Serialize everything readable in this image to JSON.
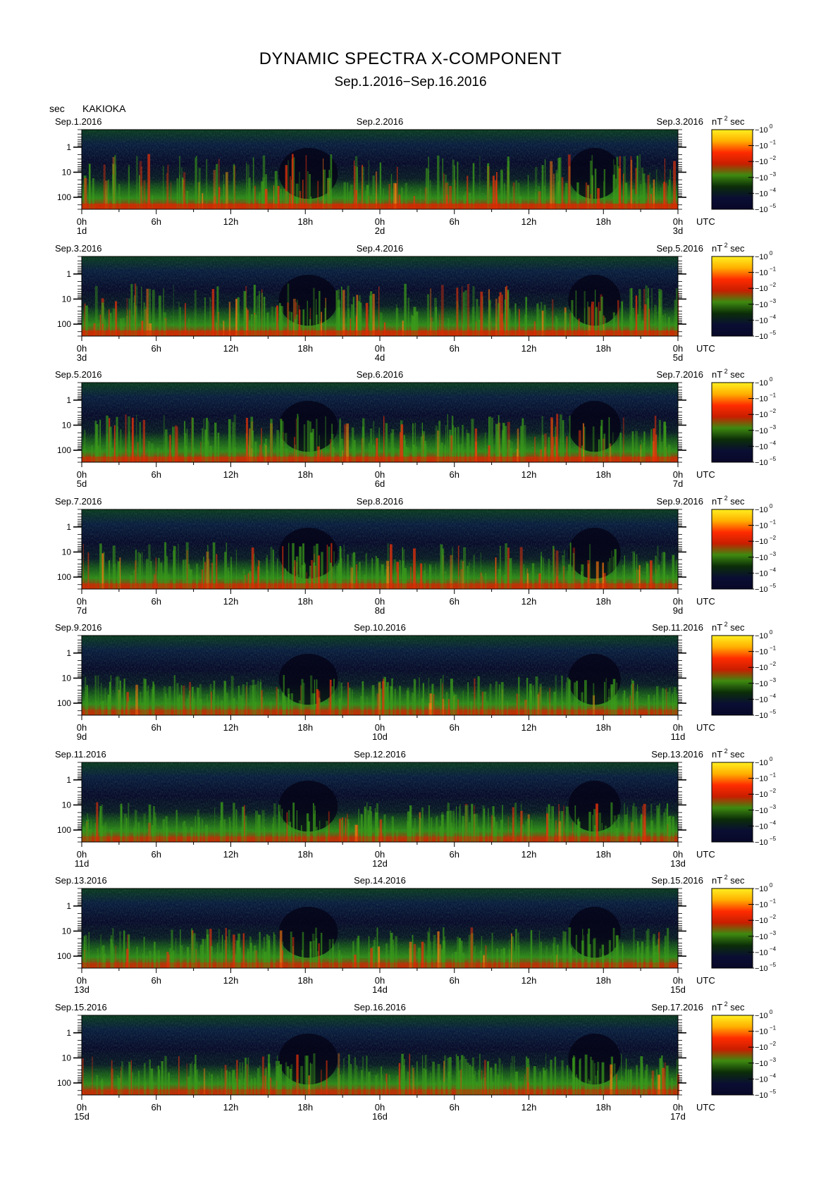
{
  "header": {
    "title": "DYNAMIC SPECTRA X-COMPONENT",
    "subtitle": "Sep.1.2016−Sep.16.2016",
    "y_unit": "sec",
    "station": "KAKIOKA"
  },
  "chart_data": {
    "type": "heatmap",
    "title": "DYNAMIC SPECTRA X-COMPONENT",
    "subtitle": "Sep.1.2016−Sep.16.2016",
    "ylabel": "sec",
    "station": "KAKIOKA",
    "y_scale": "log-reversed",
    "y_range_sec": [
      0.2,
      300
    ],
    "y_ticks": [
      "1",
      "10",
      "100"
    ],
    "x_tick_labels": [
      "0h",
      "6h",
      "12h",
      "18h",
      "0h",
      "6h",
      "12h",
      "18h",
      "0h"
    ],
    "x_unit_label": "UTC",
    "colorbar": {
      "unit": "nT",
      "unit_sup": "2",
      "unit_suffix": "sec",
      "base": "10",
      "exponents": [
        "0",
        "−1",
        "−2",
        "−3",
        "−4",
        "−5"
      ],
      "colors_top_to_bottom": [
        "#ffef20",
        "#ffb000",
        "#ff2c00",
        "#c81e00",
        "#3e8a10",
        "#0b2e08",
        "#0a0e33",
        "#080828"
      ]
    },
    "panels": [
      {
        "date_left": "Sep.1.2016",
        "date_mid": "Sep.2.2016",
        "date_right": "Sep.3.2016",
        "day_left": "1d",
        "day_mid": "2d",
        "day_right": "3d",
        "activity": 0.85
      },
      {
        "date_left": "Sep.3.2016",
        "date_mid": "Sep.4.2016",
        "date_right": "Sep.5.2016",
        "day_left": "3d",
        "day_mid": "4d",
        "day_right": "5d",
        "activity": 0.75
      },
      {
        "date_left": "Sep.5.2016",
        "date_mid": "Sep.6.2016",
        "date_right": "Sep.7.2016",
        "day_left": "5d",
        "day_mid": "6d",
        "day_right": "7d",
        "activity": 0.6
      },
      {
        "date_left": "Sep.7.2016",
        "date_mid": "Sep.8.2016",
        "date_right": "Sep.9.2016",
        "day_left": "7d",
        "day_mid": "8d",
        "day_right": "9d",
        "activity": 0.55
      },
      {
        "date_left": "Sep.9.2016",
        "date_mid": "Sep.10.2016",
        "date_right": "Sep.11.2016",
        "day_left": "9d",
        "day_mid": "10d",
        "day_right": "11d",
        "activity": 0.3
      },
      {
        "date_left": "Sep.11.2016",
        "date_mid": "Sep.12.2016",
        "date_right": "Sep.13.2016",
        "day_left": "11d",
        "day_mid": "12d",
        "day_right": "13d",
        "activity": 0.3
      },
      {
        "date_left": "Sep.13.2016",
        "date_mid": "Sep.14.2016",
        "date_right": "Sep.15.2016",
        "day_left": "13d",
        "day_mid": "14d",
        "day_right": "15d",
        "activity": 0.32
      },
      {
        "date_left": "Sep.15.2016",
        "date_mid": "Sep.16.2016",
        "date_right": "Sep.17.2016",
        "day_left": "15d",
        "day_mid": "16d",
        "day_right": "17d",
        "activity": 0.35
      }
    ]
  }
}
